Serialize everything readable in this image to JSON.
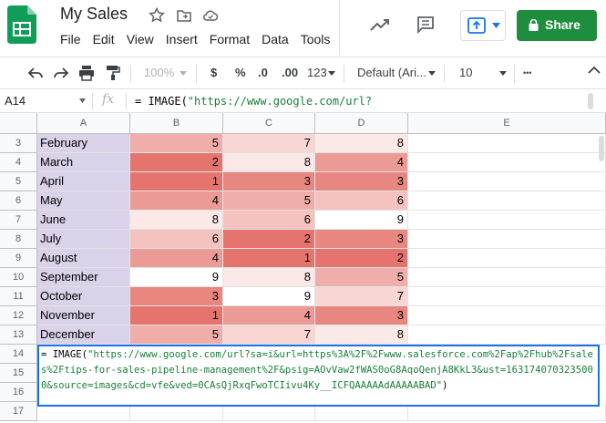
{
  "doc": {
    "title": "My Sales",
    "menu": [
      "File",
      "Edit",
      "View",
      "Insert",
      "Format",
      "Data",
      "Tools"
    ],
    "share_label": "Share"
  },
  "toolbar": {
    "zoom": "100%",
    "currency": "$",
    "percent": "%",
    "dec_less": ".0",
    "dec_more": ".00",
    "more_formats": "123",
    "font": "Default (Ari...",
    "font_size": "10",
    "more": "•••"
  },
  "formula_bar": {
    "cell_ref": "A14",
    "fx": "fx",
    "content": "= IMAGE(\"https://www.google.com/url?"
  },
  "columns": [
    "A",
    "B",
    "C",
    "D",
    "E"
  ],
  "rows": [
    {
      "n": "3",
      "month": "February",
      "b": "5",
      "c": "7",
      "d": "8"
    },
    {
      "n": "4",
      "month": "March",
      "b": "2",
      "c": "8",
      "d": "4"
    },
    {
      "n": "5",
      "month": "April",
      "b": "1",
      "c": "3",
      "d": "3"
    },
    {
      "n": "6",
      "month": "May",
      "b": "4",
      "c": "5",
      "d": "6"
    },
    {
      "n": "7",
      "month": "June",
      "b": "8",
      "c": "6",
      "d": "9"
    },
    {
      "n": "8",
      "month": "July",
      "b": "6",
      "c": "2",
      "d": "3"
    },
    {
      "n": "9",
      "month": "August",
      "b": "4",
      "c": "1",
      "d": "2"
    },
    {
      "n": "10",
      "month": "September",
      "b": "9",
      "c": "8",
      "d": "5"
    },
    {
      "n": "11",
      "month": "October",
      "b": "3",
      "c": "9",
      "d": "7"
    },
    {
      "n": "12",
      "month": "November",
      "b": "1",
      "c": "4",
      "d": "3"
    },
    {
      "n": "13",
      "month": "December",
      "b": "5",
      "c": "7",
      "d": "8"
    },
    {
      "n": "14"
    },
    {
      "n": "15"
    },
    {
      "n": "16"
    },
    {
      "n": "17"
    }
  ],
  "formula_cell": {
    "prefix": "= IMAGE(",
    "url": "\"https://www.google.com/url?sa=i&url=https%3A%2F%2Fwww.salesforce.com%2Fap%2Fhub%2Fsales%2Ftips-for-sales-pipeline-management%2F&psig=AOvVaw2fWAS0oG8AqoQenjA8KkL3&ust=1631740703235000&source=images&cd=vfe&ved=0CAsQjRxqFwoTCIivu4Ky__ICFQAAAAAdAAAAABAD\"",
    "suffix": ")"
  },
  "colors": {
    "month_fill": "#d9d2e9",
    "scale": [
      "#ffffff",
      "#fbe9e8",
      "#f8d6d4",
      "#f4c2bf",
      "#f0aeaa",
      "#ec9a95",
      "#e88680",
      "#e5746e"
    ],
    "share_green": "#1e8e3e",
    "selection_blue": "#1a73e8"
  }
}
